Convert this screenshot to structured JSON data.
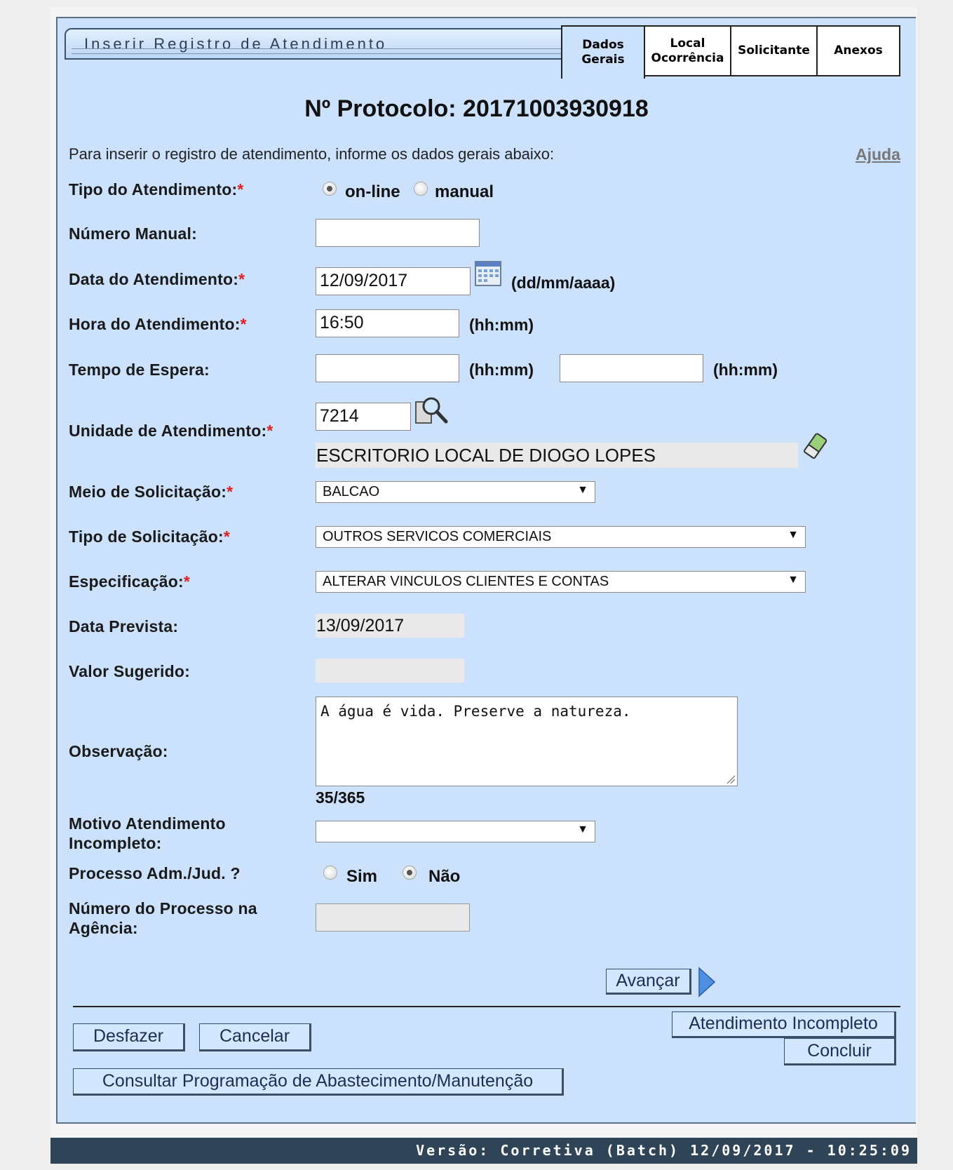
{
  "header": {
    "title": "Inserir Registro de Atendimento",
    "tabs": [
      {
        "line1": "Dados",
        "line2": "Gerais"
      },
      {
        "line1": "Local",
        "line2": "Ocorrência"
      },
      {
        "line1": "Solicitante",
        "line2": ""
      },
      {
        "line1": "Anexos",
        "line2": ""
      }
    ]
  },
  "protocol": "Nº Protocolo: 20171003930918",
  "intro": "Para inserir o registro de atendimento, informe os dados gerais abaixo:",
  "help_link": "Ajuda",
  "required_mark": "*",
  "form": {
    "tipo_atendimento": {
      "label": "Tipo do Atendimento:",
      "options": [
        "on-line",
        "manual"
      ],
      "selected": "on-line"
    },
    "numero_manual": {
      "label": "Número Manual:",
      "value": ""
    },
    "data_atendimento": {
      "label": "Data do Atendimento:",
      "value": "12/09/2017",
      "hint": "(dd/mm/aaaa)"
    },
    "hora_atendimento": {
      "label": "Hora do Atendimento:",
      "value": "16:50",
      "hint": "(hh:mm)"
    },
    "tempo_espera": {
      "label": "Tempo de Espera:",
      "value1": "",
      "hint1": "(hh:mm)",
      "value2": "",
      "hint2": "(hh:mm)"
    },
    "unidade": {
      "label": "Unidade de Atendimento:",
      "code": "7214",
      "name": "ESCRITORIO LOCAL DE DIOGO LOPES"
    },
    "meio_solicitacao": {
      "label": "Meio de Solicitação:",
      "value": "BALCAO"
    },
    "tipo_solicitacao": {
      "label": "Tipo de Solicitação:",
      "value": "OUTROS SERVICOS COMERCIAIS"
    },
    "especificacao": {
      "label": "Especificação:",
      "value": "ALTERAR VINCULOS CLIENTES E CONTAS"
    },
    "data_prevista": {
      "label": "Data Prevista:",
      "value": "13/09/2017"
    },
    "valor_sugerido": {
      "label": "Valor Sugerido:",
      "value": ""
    },
    "observacao": {
      "label": "Observação:",
      "value": "A água é vida. Preserve a natureza.",
      "counter": "35/365"
    },
    "motivo_incompleto": {
      "label_line1": "Motivo Atendimento",
      "label_line2": "Incompleto:",
      "value": ""
    },
    "processo_adm": {
      "label": "Processo Adm./Jud. ?",
      "options": [
        "Sim",
        "Não"
      ],
      "selected": "Não"
    },
    "numero_processo": {
      "label_line1": "Número do Processo na",
      "label_line2": "Agência:",
      "value": ""
    }
  },
  "buttons": {
    "avancar": "Avançar",
    "desfazer": "Desfazer",
    "cancelar": "Cancelar",
    "atendimento_incompleto": "Atendimento Incompleto",
    "concluir": "Concluir",
    "consultar": "Consultar Programação de Abastecimento/Manutenção"
  },
  "footer": "Versão: Corretiva (Batch) 12/09/2017 - 10:25:09"
}
